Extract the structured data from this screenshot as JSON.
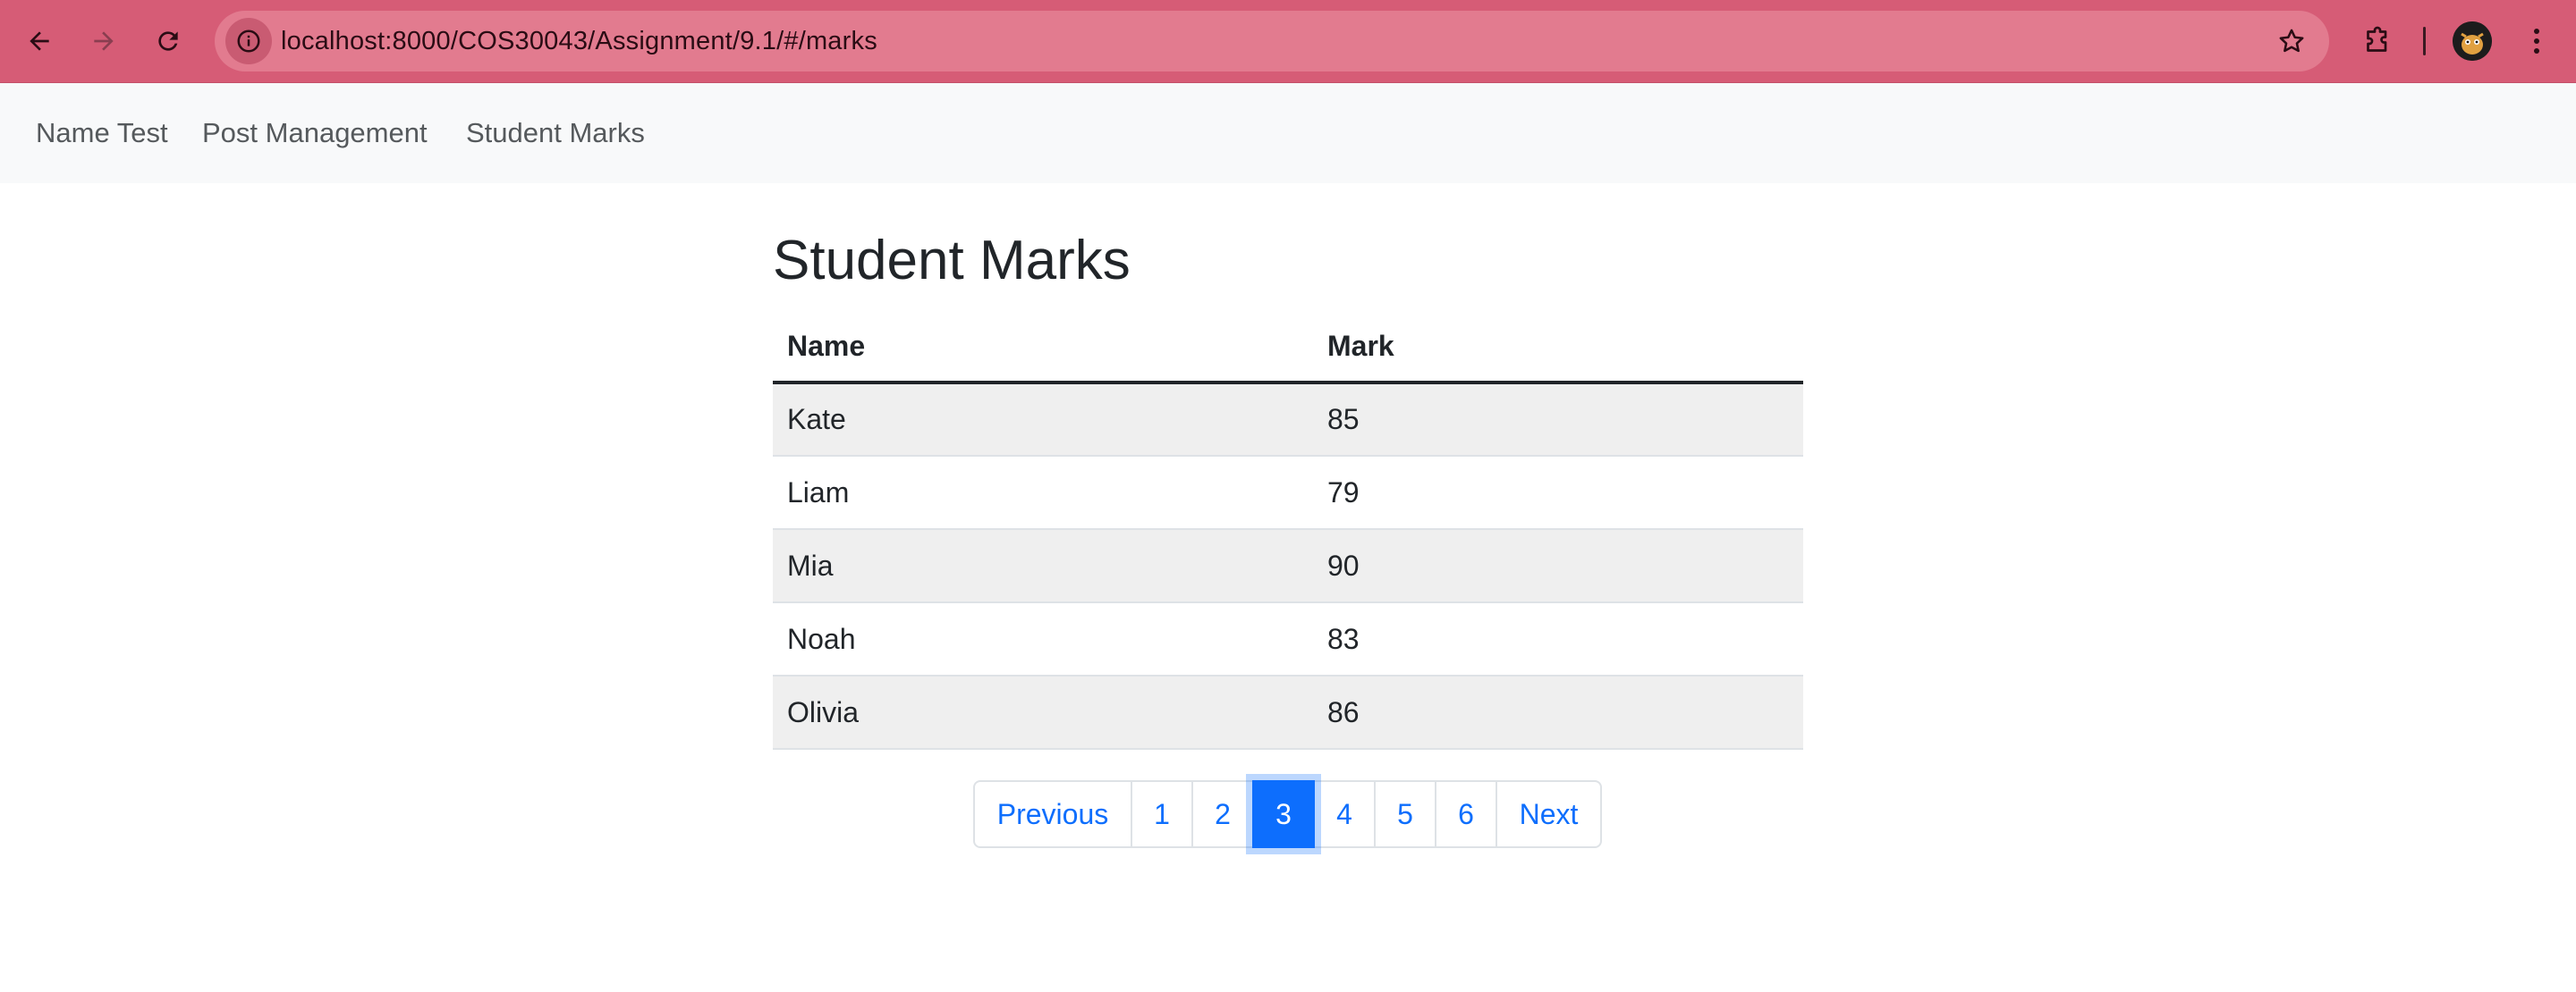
{
  "browser": {
    "url": "localhost:8000/COS30043/Assignment/9.1/#/marks",
    "back_icon": "arrow-left-icon",
    "forward_icon": "arrow-right-icon",
    "reload_icon": "reload-icon",
    "site_info_icon": "info-icon",
    "bookmark_icon": "star-icon",
    "extensions_icon": "puzzle-icon",
    "menu_icon": "kebab-menu-icon",
    "toolbar_color": "#d65c76"
  },
  "navbar": {
    "links": [
      {
        "label": "Name Test"
      },
      {
        "label": "Post Management"
      },
      {
        "label": "Student Marks"
      }
    ]
  },
  "main": {
    "title": "Student Marks",
    "table": {
      "headers": [
        "Name",
        "Mark"
      ],
      "rows": [
        {
          "name": "Kate",
          "mark": "85"
        },
        {
          "name": "Liam",
          "mark": "79"
        },
        {
          "name": "Mia",
          "mark": "90"
        },
        {
          "name": "Noah",
          "mark": "83"
        },
        {
          "name": "Olivia",
          "mark": "86"
        }
      ]
    },
    "pagination": {
      "previous_label": "Previous",
      "next_label": "Next",
      "pages": [
        "1",
        "2",
        "3",
        "4",
        "5",
        "6"
      ],
      "current_page": "3",
      "accent_color": "#0d6efd"
    }
  }
}
